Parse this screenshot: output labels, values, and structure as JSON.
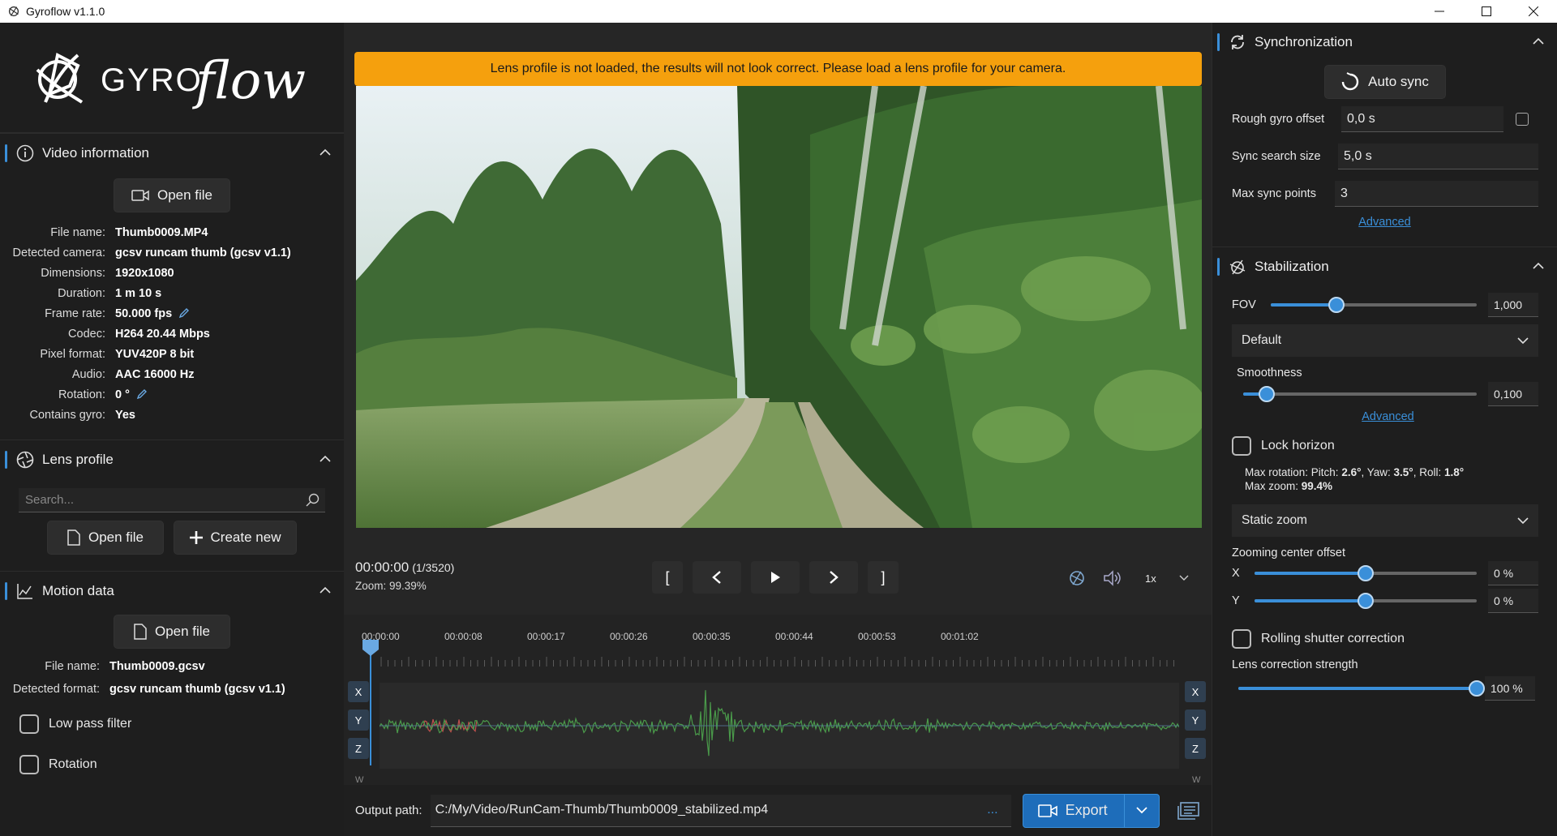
{
  "window": {
    "title": "Gyroflow v1.1.0"
  },
  "logo": {
    "text": "GYROflow"
  },
  "video_info": {
    "title": "Video information",
    "open_file": "Open file",
    "rows": [
      {
        "k": "File name:",
        "v": "Thumb0009.MP4"
      },
      {
        "k": "Detected camera:",
        "v": "gcsv runcam thumb (gcsv v1.1)"
      },
      {
        "k": "Dimensions:",
        "v": "1920x1080"
      },
      {
        "k": "Duration:",
        "v": "1 m 10 s"
      },
      {
        "k": "Frame rate:",
        "v": "50.000 fps"
      },
      {
        "k": "Codec:",
        "v": "H264 20.44 Mbps"
      },
      {
        "k": "Pixel format:",
        "v": "YUV420P 8 bit"
      },
      {
        "k": "Audio:",
        "v": "AAC 16000 Hz"
      },
      {
        "k": "Rotation:",
        "v": "0 °"
      },
      {
        "k": "Contains gyro:",
        "v": "Yes"
      }
    ]
  },
  "lens_profile": {
    "title": "Lens profile",
    "search_placeholder": "Search...",
    "open_file": "Open file",
    "create_new": "Create new"
  },
  "motion_data": {
    "title": "Motion data",
    "open_file": "Open file",
    "file_name_label": "File name:",
    "file_name": "Thumb0009.gcsv",
    "format_label": "Detected format:",
    "format": "gcsv runcam thumb (gcsv v1.1)",
    "low_pass": "Low pass filter",
    "rotation": "Rotation"
  },
  "player": {
    "warning": "Lens profile is not loaded, the results will not look correct. Please load a lens profile for your camera.",
    "time": "00:00:00",
    "frame": "(1/3520)",
    "zoom": "Zoom: 99.39%",
    "speed": "1x",
    "btn_in": "[",
    "btn_out": "]"
  },
  "timeline": {
    "labels": [
      "00:00:00",
      "00:00:08",
      "00:00:17",
      "00:00:26",
      "00:00:35",
      "00:00:44",
      "00:00:53",
      "00:01:02"
    ],
    "axes": [
      "X",
      "Y",
      "Z"
    ],
    "w_label": "W"
  },
  "output": {
    "label": "Output path:",
    "path": "C:/My/Video/RunCam-Thumb/Thumb0009_stabilized.mp4",
    "dots": "...",
    "export": "Export"
  },
  "sync": {
    "title": "Synchronization",
    "auto_sync": "Auto sync",
    "rough_label": "Rough gyro offset",
    "rough_value": "0,0 s",
    "search_label": "Sync search size",
    "search_value": "5,0 s",
    "points_label": "Max sync points",
    "points_value": "3",
    "advanced": "Advanced"
  },
  "stabilization": {
    "title": "Stabilization",
    "fov_label": "FOV",
    "fov_value": "1,000",
    "fov_level": 0.32,
    "method": "Default",
    "smoothness_label": "Smoothness",
    "smoothness_value": "0,100",
    "smoothness_level": 0.1,
    "advanced": "Advanced",
    "lock_horizon": "Lock horizon",
    "max_rot_prefix": "Max rotation: Pitch: ",
    "pitch": "2.6°",
    "yaw_prefix": ", Yaw: ",
    "yaw": "3.5°",
    "roll_prefix": ", Roll: ",
    "roll": "1.8°",
    "max_zoom_prefix": "Max zoom: ",
    "max_zoom": "99.4%",
    "zoom_mode": "Static zoom",
    "zoom_center_label": "Zooming center offset",
    "x_label": "X",
    "x_value": "0 %",
    "x_level": 0.5,
    "y_label": "Y",
    "y_value": "0 %",
    "y_level": 0.5,
    "rolling_shutter": "Rolling shutter correction",
    "lens_strength_label": "Lens correction strength",
    "lens_strength_value": "100 %",
    "lens_strength_level": 1.0
  },
  "colors": {
    "accent": "#3a8fd9",
    "warning": "#f5a00d"
  }
}
